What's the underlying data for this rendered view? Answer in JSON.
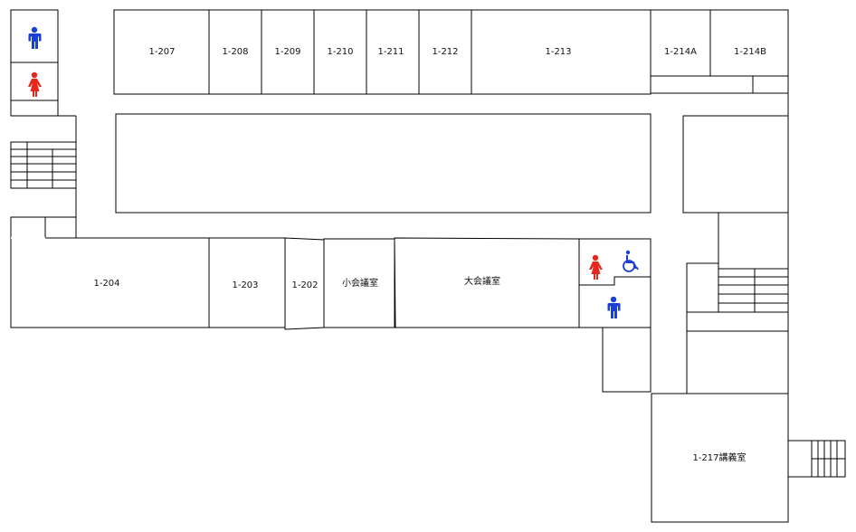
{
  "map": {
    "rooms": {
      "r207": "1-207",
      "r208": "1-208",
      "r209": "1-209",
      "r210": "1-210",
      "r211": "1-211",
      "r212": "1-212",
      "r213": "1-213",
      "r214a": "1-214A",
      "r214b": "1-214B",
      "r204": "1-204",
      "r203": "1-203",
      "r202": "1-202",
      "small_meeting": "小会議室",
      "large_meeting": "大会議室",
      "r217": "1-217講義室"
    },
    "icons": {
      "mens_restroom": "mens-restroom-icon",
      "womens_restroom": "womens-restroom-icon",
      "accessible_restroom": "wheelchair-icon",
      "stairs": "stairs-icon"
    },
    "colors": {
      "mens": "#1a3fd6",
      "womens": "#e8261c",
      "accessible": "#1a3fd6",
      "walls": "#000000",
      "background": "#ffffff"
    }
  }
}
